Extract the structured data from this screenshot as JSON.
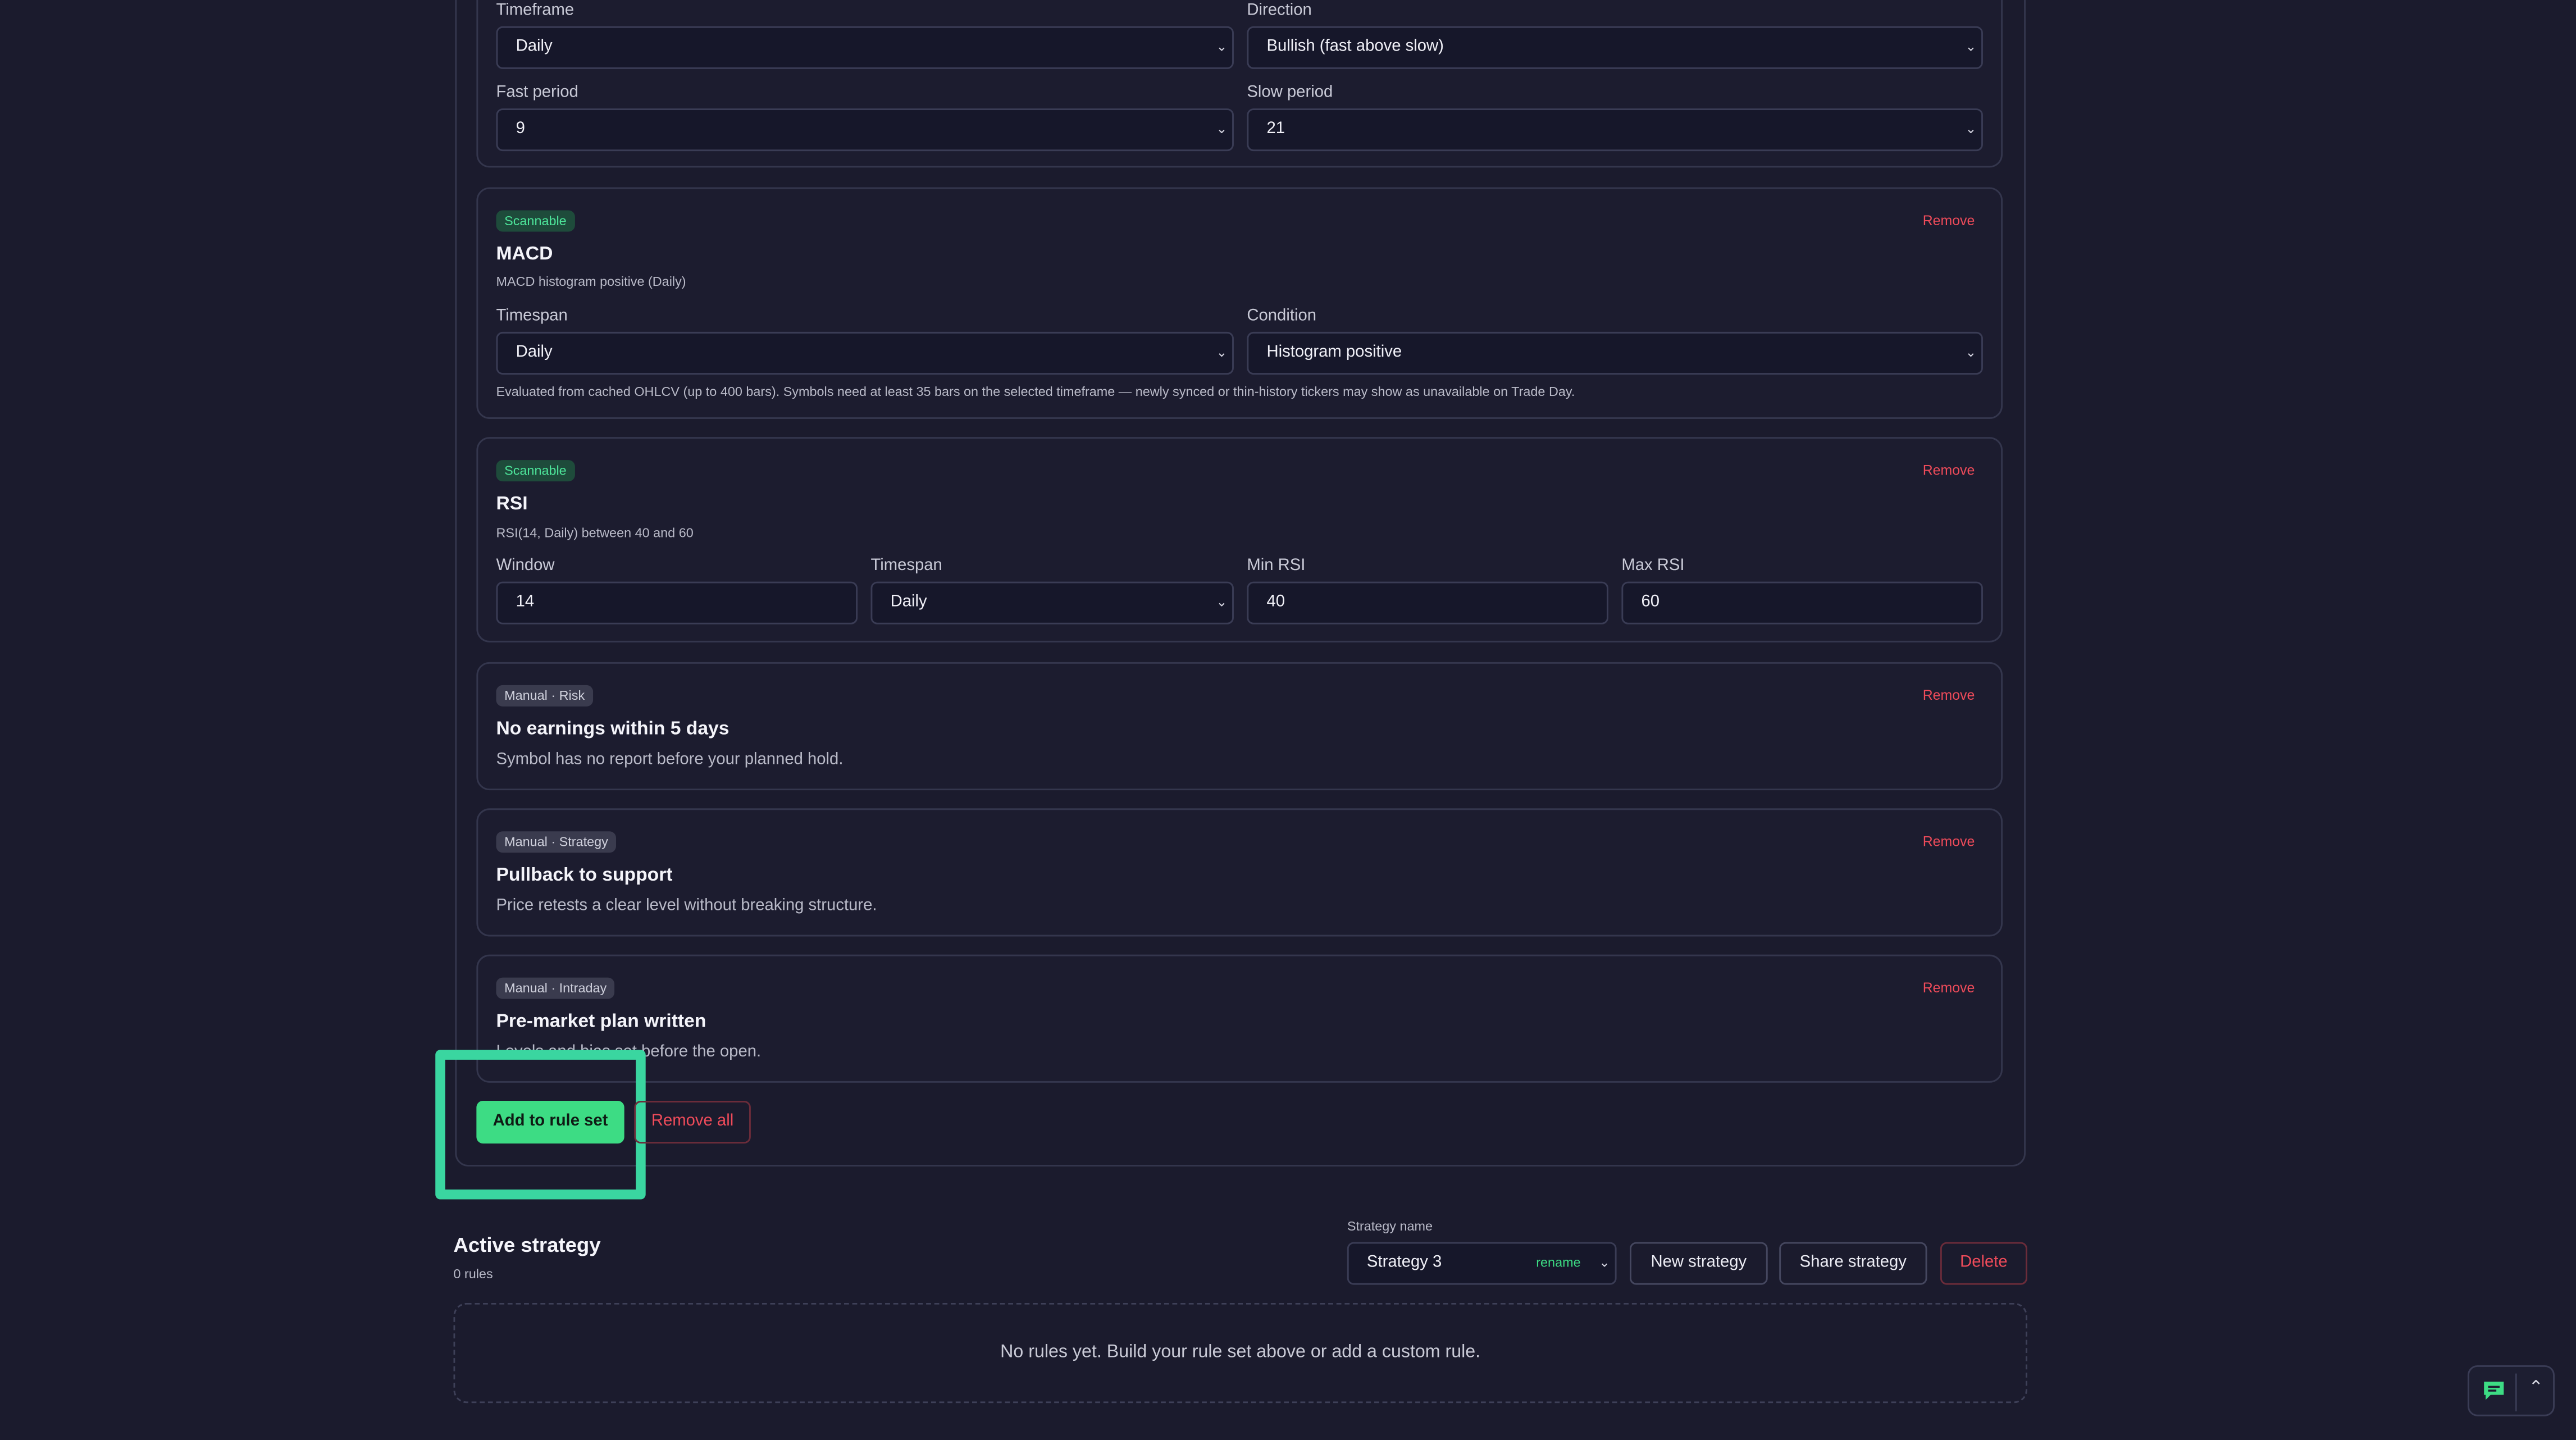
{
  "rule_set": {
    "ma_card": {
      "timeframe_label": "Timeframe",
      "timeframe_value": "Daily",
      "direction_label": "Direction",
      "direction_value": "Bullish (fast above slow)",
      "fast_label": "Fast period",
      "fast_value": "9",
      "slow_label": "Slow period",
      "slow_value": "21"
    },
    "macd_card": {
      "badge": "Scannable",
      "remove": "Remove",
      "title": "MACD",
      "subtitle": "MACD histogram positive (Daily)",
      "timespan_label": "Timespan",
      "timespan_value": "Daily",
      "condition_label": "Condition",
      "condition_value": "Histogram positive",
      "note": "Evaluated from cached OHLCV (up to 400 bars). Symbols need at least 35 bars on the selected timeframe — newly synced or thin-history tickers may show as unavailable on Trade Day."
    },
    "rsi_card": {
      "badge": "Scannable",
      "remove": "Remove",
      "title": "RSI",
      "subtitle": "RSI(14, Daily) between 40 and 60",
      "window_label": "Window",
      "window_value": "14",
      "timespan_label": "Timespan",
      "timespan_value": "Daily",
      "min_label": "Min RSI",
      "min_value": "40",
      "max_label": "Max RSI",
      "max_value": "60"
    },
    "earnings_card": {
      "badge": "Manual · Risk",
      "remove": "Remove",
      "title": "No earnings within 5 days",
      "description": "Symbol has no report before your planned hold."
    },
    "pullback_card": {
      "badge": "Manual · Strategy",
      "remove": "Remove",
      "title": "Pullback to support",
      "description": "Price retests a clear level without breaking structure."
    },
    "premarket_card": {
      "badge": "Manual · Intraday",
      "remove": "Remove",
      "title": "Pre-market plan written",
      "description": "Levels and bias set before the open."
    },
    "add_button": "Add to rule set",
    "remove_all_button": "Remove all"
  },
  "active_strategy": {
    "title": "Active strategy",
    "count": "0 rules",
    "name_label": "Strategy name",
    "name_value": "Strategy 3",
    "rename": "rename",
    "new_button": "New strategy",
    "share_button": "Share strategy",
    "delete_button": "Delete",
    "empty_message": "No rules yet. Build your rule set above or add a custom rule."
  },
  "colors": {
    "accent_green": "#3ddc84",
    "danger_red": "#ef4b5a",
    "highlight_box": "#3ad6a0",
    "background": "#1b1b2d"
  },
  "icons": {
    "feedback": "chat-icon",
    "scroll_top": "chevron-up-icon",
    "dropdown": "chevron-down-icon"
  }
}
